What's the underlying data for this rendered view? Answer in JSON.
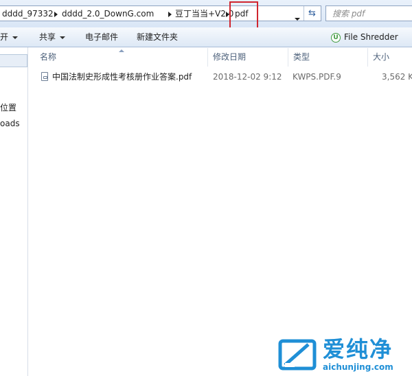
{
  "address_bar": {
    "breadcrumbs": [
      "dddd_97332",
      "dddd_2.0_DownG.com",
      "豆丁当当+V2.0",
      "pdf"
    ],
    "search_placeholder": "搜索 pdf"
  },
  "toolbar": {
    "open_label": "开",
    "share_label": "共享",
    "email_label": "电子邮件",
    "new_folder_label": "新建文件夹",
    "shredder_label": "File Shredder"
  },
  "nav_pane": {
    "items": [
      "位置",
      "oads"
    ]
  },
  "columns": {
    "name": "名称",
    "modified": "修改日期",
    "type": "类型",
    "size": "大小"
  },
  "files": [
    {
      "name": "中国法制史形成性考核册作业答案.pdf",
      "modified": "2018-12-02 9:12",
      "type": "KWPS.PDF.9",
      "size": "3,562 KB"
    }
  ],
  "watermark": {
    "brand": "爱纯净",
    "url": "aichunjing.com"
  },
  "colors": {
    "highlight_box": "#d0252e",
    "watermark": "#1f8fd6",
    "column_header_text": "#4c607a"
  }
}
